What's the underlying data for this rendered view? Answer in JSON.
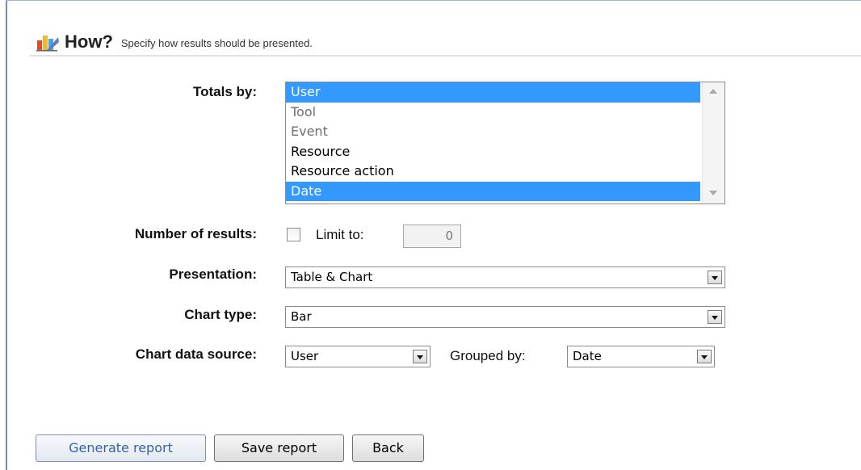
{
  "header": {
    "title": "How?",
    "subtitle": "Specify how results should be presented."
  },
  "totals_by": {
    "label": "Totals by:",
    "items": [
      {
        "label": "User",
        "selected": true,
        "disabled": false
      },
      {
        "label": "Tool",
        "selected": false,
        "disabled": true
      },
      {
        "label": "Event",
        "selected": false,
        "disabled": true
      },
      {
        "label": "Resource",
        "selected": false,
        "disabled": false
      },
      {
        "label": "Resource action",
        "selected": false,
        "disabled": false
      },
      {
        "label": "Date",
        "selected": true,
        "disabled": false
      }
    ]
  },
  "number_of_results": {
    "label": "Number of results:",
    "checkbox_label": "Limit to:",
    "checked": false,
    "limit_value": "0"
  },
  "presentation": {
    "label": "Presentation:",
    "value": "Table & Chart"
  },
  "chart_type": {
    "label": "Chart type:",
    "value": "Bar"
  },
  "chart_data_source": {
    "label": "Chart data source:",
    "value": "User",
    "grouped_by_label": "Grouped by:",
    "grouped_by_value": "Date"
  },
  "buttons": {
    "generate": "Generate report",
    "save": "Save report",
    "back": "Back"
  },
  "colors": {
    "selection": "#3399ff",
    "frame": "#6f8fbf"
  }
}
